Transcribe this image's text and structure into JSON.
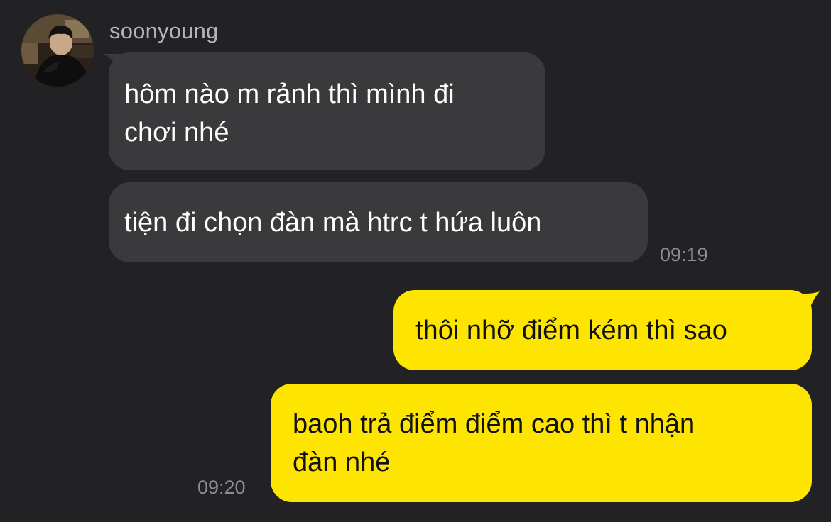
{
  "contact": {
    "name": "soonyoung",
    "avatar_icon": "profile-photo"
  },
  "messages": [
    {
      "side": "incoming",
      "text": "hôm nào m rảnh thì mình đi\nchơi nhé"
    },
    {
      "side": "incoming",
      "text": "tiện đi chọn đàn mà htrc t hứa luôn",
      "time": "09:19"
    },
    {
      "side": "outgoing",
      "text": "thôi nhỡ điểm kém thì sao"
    },
    {
      "side": "outgoing",
      "text": "baoh trả điểm điểm cao thì t nhận\nđàn nhé",
      "time": "09:20"
    }
  ],
  "colors": {
    "background": "#222224",
    "incoming_bubble": "#3a3a3c",
    "outgoing_bubble": "#fee500",
    "timestamp": "#8d8d90"
  }
}
